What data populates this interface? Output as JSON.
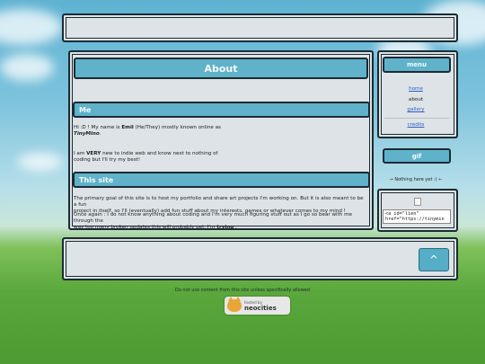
{
  "header": {
    "title": ""
  },
  "about": {
    "title": "About",
    "me_heading": "Me",
    "me_line1_pre": "Hi :D ! My name is ",
    "me_name": "Emil",
    "me_line1_post": " (He/They) mostly known online as",
    "me_alias": "TinyMino",
    "me_alias_end": ".",
    "me_line2_pre": "I am ",
    "me_very": "VERY",
    "me_line2_post": " new to indie web and know next to nothing of",
    "me_line3": "coding but I'll try my best!",
    "site_heading": "This site",
    "site_p1_line1": "The primary goal of this site is to host my portfolio and share art projects I'm working on. But it is also meant to be a fun",
    "site_p1_line2": "project in itself, so I'll (eventually) add fun stuff about my interests, games or whatever comes to my mind !",
    "site_p2_line1": "Once again : I do not know anything about coding and I'm very much figuring stuff out as I go so bear with me through the",
    "site_p2_line2_pre": "way too many broken updates this will probably get. I'm ",
    "site_p2_trying": "trying",
    "site_p2_end": " ."
  },
  "menu": {
    "title": "menu",
    "items": [
      "home",
      "about",
      "gallery",
      "credits"
    ]
  },
  "gif": {
    "title": "gif",
    "note": "→ Nothing here yet :( ←"
  },
  "button_code": "<a id=\"lien\"\nhref=\"https://tinymin",
  "footer": {
    "note": "Do not use content from this site unless specifically allowed",
    "badge_small": "hosted by",
    "badge_big": "neocities"
  },
  "back_to_top": "^"
}
